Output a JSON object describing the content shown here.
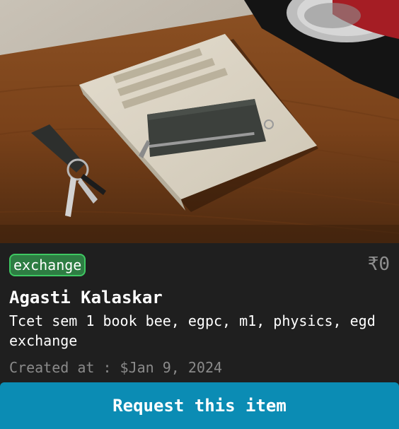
{
  "listing": {
    "image_alt": "Book with wallet and keys on wooden table",
    "type_badge": "exchange",
    "price": "₹0",
    "owner_name": "Agasti Kalaskar",
    "description": "Tcet sem 1 book bee, egpc, m1, physics, egd exchange",
    "created_label": "Created at : ",
    "created_value": "$Jan 9, 2024"
  },
  "actions": {
    "request_label": "Request this item"
  },
  "colors": {
    "card_bg": "#1f1f1f",
    "badge_bg": "#2e7d43",
    "badge_border": "#3ec862",
    "button_bg": "#0b8cb4",
    "muted_text": "#8a8a8a"
  }
}
